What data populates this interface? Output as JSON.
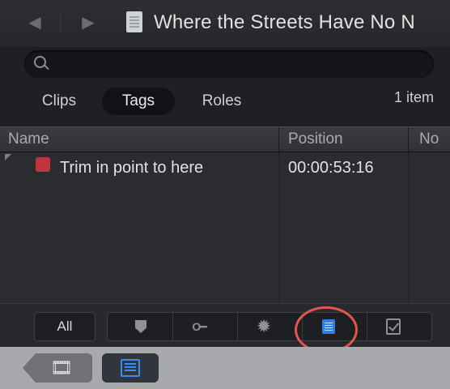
{
  "header": {
    "title": "Where the Streets Have No N",
    "back_icon": "chevron-left-icon",
    "forward_icon": "chevron-right-icon",
    "document_icon": "document-icon"
  },
  "search": {
    "placeholder": "",
    "value": ""
  },
  "segments": {
    "clips": "Clips",
    "tags": "Tags",
    "roles": "Roles",
    "selected": "Tags"
  },
  "item_count": "1 item",
  "table": {
    "columns": [
      "Name",
      "Position",
      "No"
    ],
    "rows": [
      {
        "name": "Trim in point to here",
        "position": "00:00:53:16",
        "tag_color": "#c0343b"
      }
    ]
  },
  "toolbar": {
    "all_label": "All",
    "filters": [
      "marker-icon",
      "keyword-icon",
      "gear-icon",
      "to-do-list-icon",
      "completed-check-icon"
    ],
    "selected_filter": "to-do-list-icon",
    "highlight_color": "#e2574c"
  },
  "bottom_bar": {
    "tabs": [
      "film-reel-icon",
      "timeline-index-icon"
    ]
  }
}
